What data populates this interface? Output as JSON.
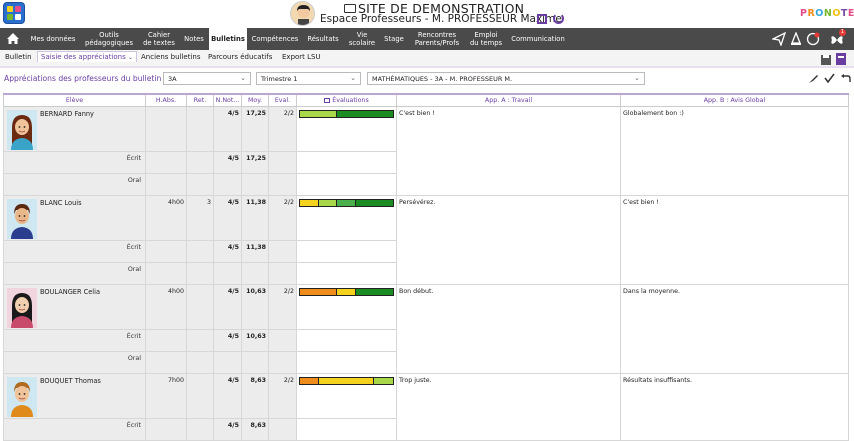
{
  "header": {
    "site_title": "SITE DE DEMONSTRATION",
    "site_subtitle": "Espace Professeurs - M. PROFESSEUR Maxime",
    "brand": [
      "P",
      "R",
      "O",
      "N",
      "O",
      "T",
      "E"
    ]
  },
  "nav": {
    "items": [
      {
        "label": "Mes données"
      },
      {
        "label": "Outils\npédagogiques"
      },
      {
        "label": "Cahier\nde textes"
      },
      {
        "label": "Notes"
      },
      {
        "label": "Bulletins"
      },
      {
        "label": "Compétences"
      },
      {
        "label": "Résultats"
      },
      {
        "label": "Vie\nscolaire"
      },
      {
        "label": "Stage"
      },
      {
        "label": "Rencontres\nParents/Profs"
      },
      {
        "label": "Emploi\ndu temps"
      },
      {
        "label": "Communication"
      }
    ],
    "notification_count": "1"
  },
  "subtabs": {
    "items": [
      {
        "label": "Bulletin"
      },
      {
        "label": "Saisie des appréciations"
      },
      {
        "label": "Anciens bulletins"
      },
      {
        "label": "Parcours éducatifs"
      },
      {
        "label": "Export LSU"
      }
    ]
  },
  "filters": {
    "title": "Appréciations des professeurs du bulletin",
    "class_value": "3A",
    "period_value": "Trimestre 1",
    "service_value": "MATHÉMATIQUES - 3A - M. PROFESSEUR M."
  },
  "table": {
    "headers": [
      "Elève",
      "H.Abs.",
      "Ret.",
      "N.Not...",
      "Moy.",
      "Eval.",
      "Évaluations",
      "App. A : Travail",
      "App. B : Avis Global"
    ],
    "students": [
      {
        "name": "BERNARD Fanny",
        "habs": "",
        "ret": "",
        "nnot": "4/5",
        "moy": "17,25",
        "eval": "2/2",
        "app_a": "C'est bien !",
        "app_b": "Globalement bon :)",
        "bar": [
          {
            "color": "#a8d84a",
            "pct": 0.4
          },
          {
            "color": "#1a8c22",
            "pct": 0.6
          }
        ],
        "ecrit": {
          "label": "Écrit",
          "nnot": "4/5",
          "moy": "17,25"
        },
        "oral": {
          "label": "Oral"
        }
      },
      {
        "name": "BLANC Louis",
        "habs": "4h00",
        "ret": "3",
        "nnot": "4/5",
        "moy": "11,38",
        "eval": "2/2",
        "app_a": "Persévérez.",
        "app_b": "C'est bien !",
        "bar": [
          {
            "color": "#f5d21e",
            "pct": 0.2
          },
          {
            "color": "#a8d84a",
            "pct": 0.2
          },
          {
            "color": "#4bb04b",
            "pct": 0.2
          },
          {
            "color": "#1a8c22",
            "pct": 0.4
          }
        ],
        "ecrit": {
          "label": "Écrit",
          "nnot": "4/5",
          "moy": "11,38"
        },
        "oral": {
          "label": "Oral"
        }
      },
      {
        "name": "BOULANGER Celia",
        "habs": "4h00",
        "ret": "",
        "nnot": "4/5",
        "moy": "10,63",
        "eval": "2/2",
        "app_a": "Bon début.",
        "app_b": "Dans la moyenne.",
        "bar": [
          {
            "color": "#f08c1c",
            "pct": 0.4
          },
          {
            "color": "#f5d21e",
            "pct": 0.2
          },
          {
            "color": "#1a8c22",
            "pct": 0.4
          }
        ],
        "ecrit": {
          "label": "Écrit",
          "nnot": "4/5",
          "moy": "10,63"
        },
        "oral": {
          "label": "Oral"
        }
      },
      {
        "name": "BOUQUET Thomas",
        "habs": "7h00",
        "ret": "",
        "nnot": "4/5",
        "moy": "8,63",
        "eval": "2/2",
        "app_a": "Trop juste.",
        "app_b": "Résultats insuffisants.",
        "bar": [
          {
            "color": "#f08c1c",
            "pct": 0.2
          },
          {
            "color": "#f5d21e",
            "pct": 0.6
          },
          {
            "color": "#a8d84a",
            "pct": 0.2
          }
        ],
        "ecrit": {
          "label": "Écrit",
          "nnot": "4/5",
          "moy": "8,63"
        }
      }
    ]
  }
}
